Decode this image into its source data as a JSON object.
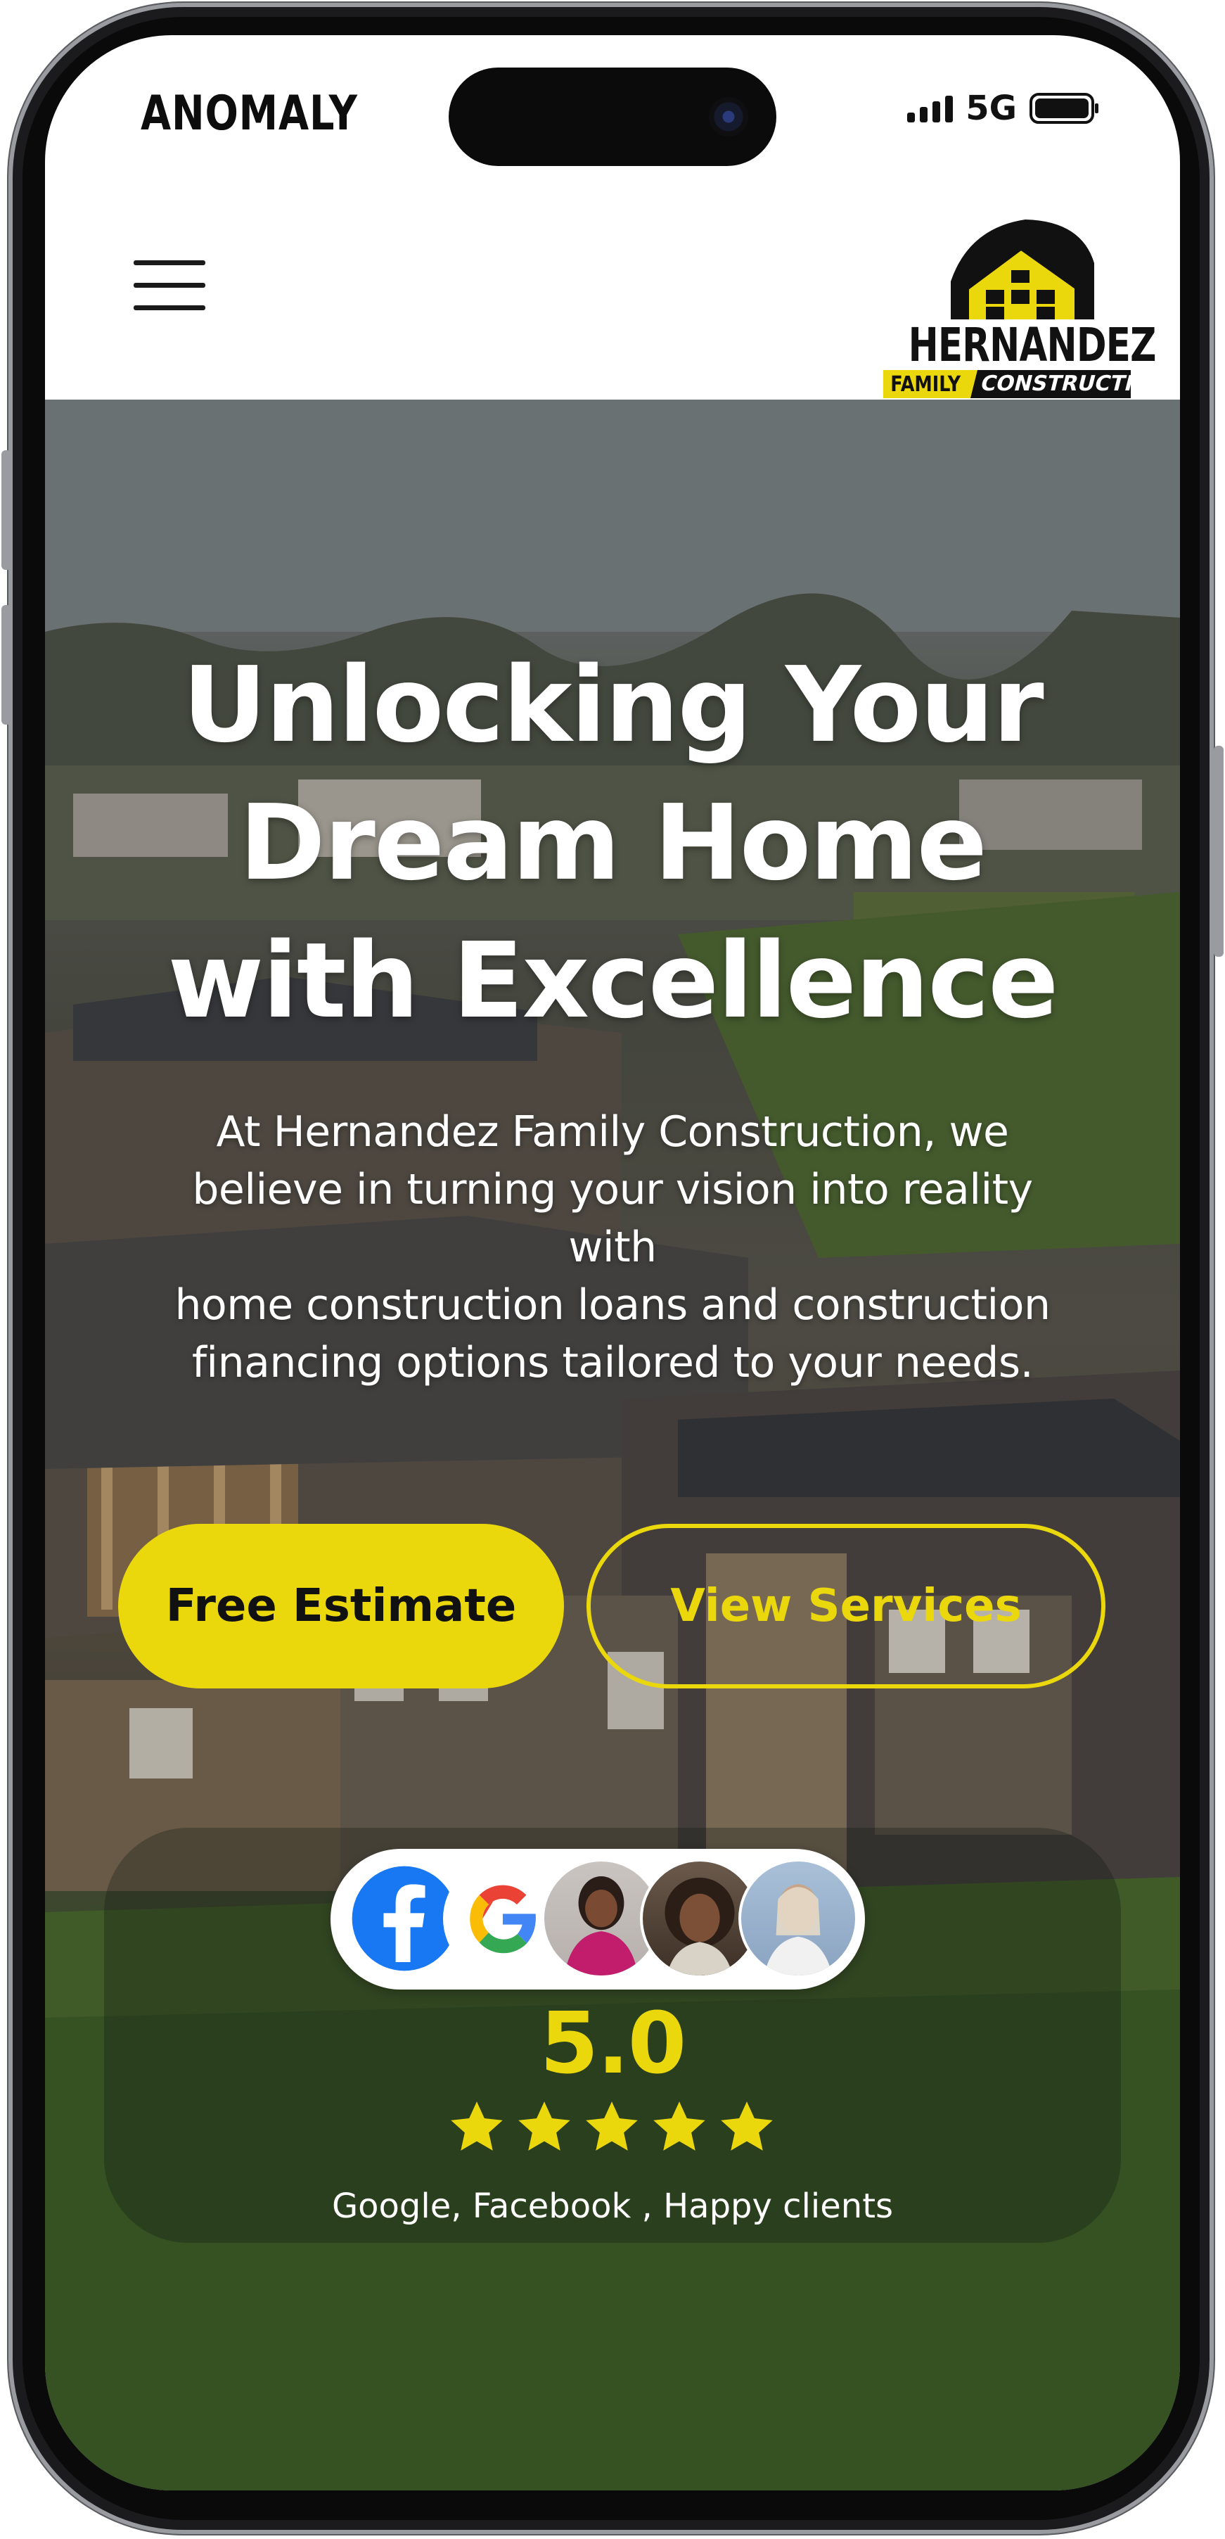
{
  "status_bar": {
    "carrier": "ANOMALY",
    "network": "5G",
    "signal_bars": 4,
    "battery_level": 1.0
  },
  "header": {
    "menu_icon": "hamburger-menu-icon",
    "logo": {
      "name": "HERNANDEZ",
      "tagline_left": "FAMILY",
      "tagline_right": "CONSTRUCTION"
    }
  },
  "hero": {
    "title_lines": [
      "Unlocking Your",
      "Dream Home",
      "with Excellence"
    ],
    "subtitle_lines": [
      "At Hernandez Family Construction, we",
      "believe in turning your vision into reality",
      "with",
      "home construction loans and construction",
      "financing options tailored to your needs."
    ],
    "primary_button": "Free Estimate",
    "secondary_button": "View Services",
    "accent_color": "#ebd80c"
  },
  "reviews": {
    "avatars": [
      "facebook-logo-icon",
      "google-logo-icon",
      "client-photo-1",
      "client-photo-2",
      "client-photo-3"
    ],
    "rating": "5.0",
    "stars": 5,
    "sources": "Google, Facebook , Happy clients"
  }
}
